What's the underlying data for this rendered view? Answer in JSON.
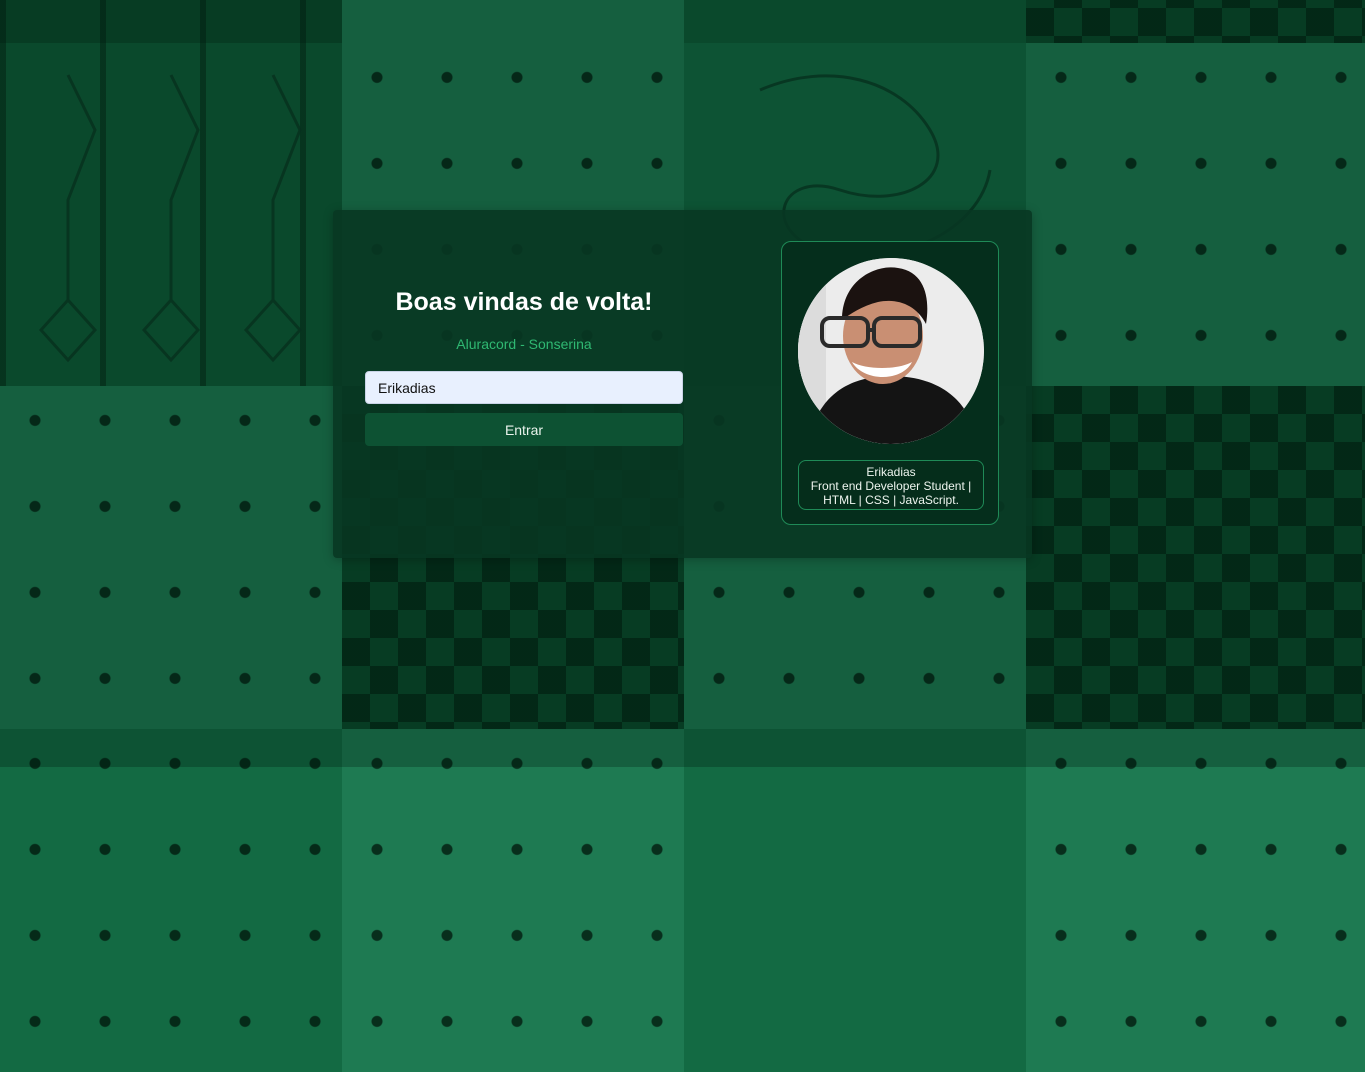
{
  "login": {
    "title": "Boas vindas de volta!",
    "subtitle": "Aluracord - Sonserina",
    "username_value": "Erikadias",
    "submit_label": "Entrar"
  },
  "profile": {
    "username": "Erikadias",
    "bio_line_1": "Front end Developer Student |",
    "bio_line_2": "HTML | CSS | JavaScript."
  },
  "colors": {
    "accent": "#2fb872",
    "panel": "#08372a",
    "button": "#0d5233",
    "input_bg": "#e8f0fe"
  }
}
